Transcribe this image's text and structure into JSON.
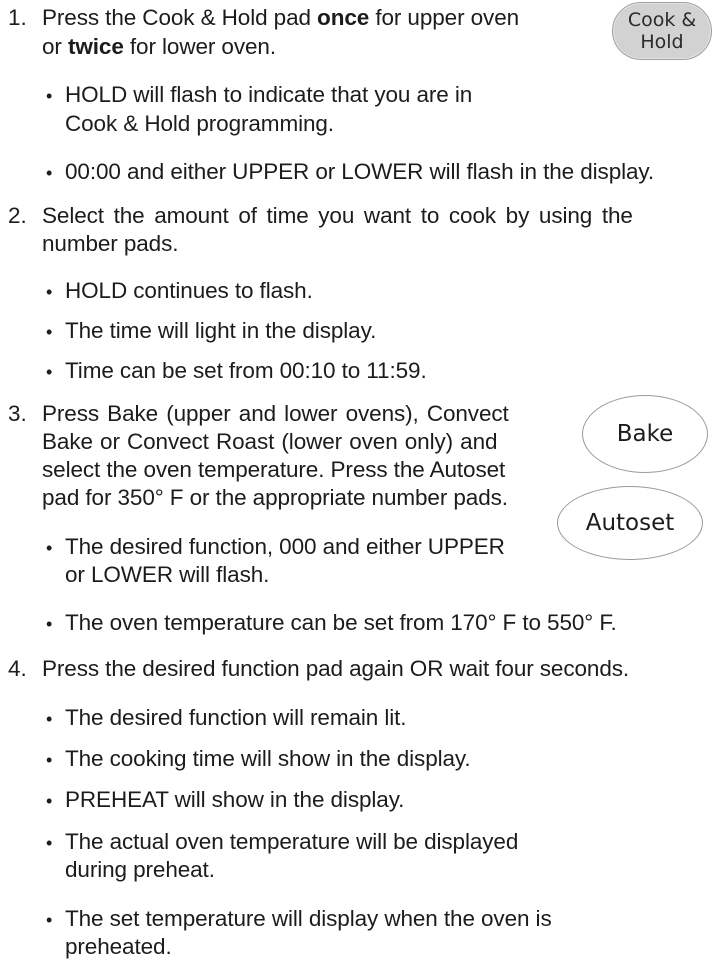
{
  "steps": [
    {
      "number": "1.",
      "line1_pre": "Press the Cook & Hold pad ",
      "line1_b1": "once",
      "line1_post": " for upper oven",
      "line2_b": "twice",
      "line2_pre": "or ",
      "line2_post": " for lower oven.",
      "bullets": [
        {
          "l1": "HOLD will flash to indicate that you are in",
          "l2": "Cook & Hold programming."
        },
        {
          "l1": "00:00 and either UPPER or LOWER will flash in the display."
        }
      ]
    },
    {
      "number": "2.",
      "line1": "Select the amount of time you want to cook by using the",
      "line2": "number pads.",
      "bullets": [
        {
          "l1": "HOLD continues to flash."
        },
        {
          "l1": "The time will light in the display."
        },
        {
          "l1": "Time can be set from 00:10 to 11:59."
        }
      ]
    },
    {
      "number": "3.",
      "line1": "Press Bake (upper and lower ovens), Convect",
      "line2": "Bake or Convect Roast (lower oven only) and",
      "line3": "select the oven temperature. Press the Autoset",
      "line4": "pad for 350° F or the appropriate number pads.",
      "bullets": [
        {
          "l1": "The desired function, 000 and either UPPER",
          "l2": "or LOWER will flash."
        },
        {
          "l1": "The oven temperature can be set from 170° F to 550° F."
        }
      ]
    },
    {
      "number": "4.",
      "line1": "Press the desired function pad again OR wait four seconds.",
      "bullets": [
        {
          "l1": "The desired function will remain lit."
        },
        {
          "l1": "The cooking time will show in the display."
        },
        {
          "l1": "PREHEAT will show in the display."
        },
        {
          "l1": "The actual oven temperature will be displayed",
          "l2": "during preheat."
        },
        {
          "l1": "The set temperature will display when the oven is",
          "l2": "preheated."
        }
      ]
    }
  ],
  "pads": {
    "cook_hold_line1": "Cook &",
    "cook_hold_line2": "Hold",
    "bake": "Bake",
    "autoset": "Autoset"
  },
  "bullet_glyph": "•"
}
